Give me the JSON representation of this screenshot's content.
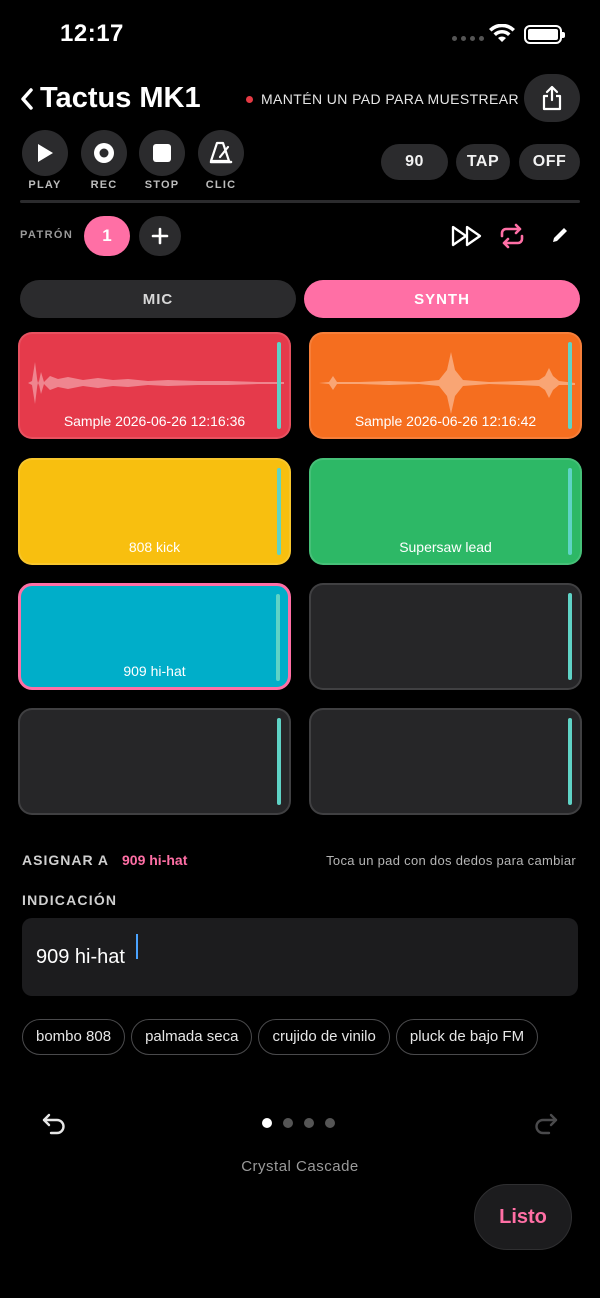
{
  "status": {
    "time": "12:17"
  },
  "header": {
    "title": "Tactus MK1",
    "hint": "MANTÉN UN PAD PARA MUESTREAR"
  },
  "transport": {
    "play": "PLAY",
    "rec": "REC",
    "stop": "STOP",
    "click": "CLIC",
    "bpm": "90",
    "tap": "TAP",
    "off": "OFF"
  },
  "pattern": {
    "label": "PATRÓN",
    "current": "1"
  },
  "modes": {
    "mic": "MIC",
    "synth": "SYNTH",
    "active": "SYNTH"
  },
  "pads": [
    {
      "label": "Sample 2026-06-26 12:16:36",
      "color": "#e53a4b",
      "waveform": true
    },
    {
      "label": "Sample 2026-06-26 12:16:42",
      "color": "#f56e1f",
      "waveform": true
    },
    {
      "label": "808 kick",
      "color": "#f8bf0f",
      "waveform": false
    },
    {
      "label": "Supersaw lead",
      "color": "#2db866",
      "waveform": false
    },
    {
      "label": "909 hi-hat",
      "color": "#00aec9",
      "waveform": false,
      "selected": true
    },
    {
      "label": "",
      "color": "#262628",
      "waveform": false
    },
    {
      "label": "",
      "color": "#262628",
      "waveform": false
    },
    {
      "label": "",
      "color": "#262628",
      "waveform": false
    }
  ],
  "assign": {
    "label": "ASIGNAR A",
    "target": "909 hi-hat",
    "hint": "Toca un pad con dos dedos para cambiar"
  },
  "prompt": {
    "label": "INDICACIÓN",
    "value": "909 hi-hat"
  },
  "chips": [
    "bombo 808",
    "palmada seca",
    "crujido de vinilo",
    "pluck de bajo FM"
  ],
  "pager": {
    "count": 4,
    "active": 0
  },
  "preset_name": "Crystal Cascade",
  "done_label": "Listo",
  "colors": {
    "accent": "#ff6fa5",
    "level_meter": "#5fd3c6",
    "rec_dot": "#e53a44"
  }
}
